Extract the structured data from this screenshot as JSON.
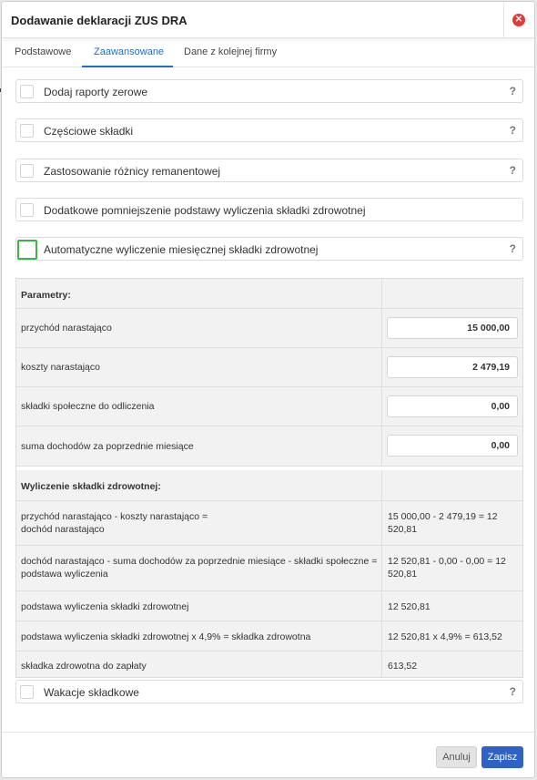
{
  "dialog": {
    "title": "Dodawanie deklaracji ZUS DRA",
    "close_glyph": "✕"
  },
  "tabs": [
    {
      "label": "Podstawowe",
      "active": false
    },
    {
      "label": "Zaawansowane",
      "active": true
    },
    {
      "label": "Dane z kolejnej firmy",
      "active": false
    }
  ],
  "options": [
    {
      "label": "Dodaj raporty zerowe",
      "help": "?",
      "checked": false
    },
    {
      "label": "Częściowe składki",
      "help": "?",
      "checked": false
    },
    {
      "label": "Zastosowanie różnicy remanentowej",
      "help": "?",
      "checked": false
    },
    {
      "label": "Dodatkowe pomniejszenie podstawy wyliczenia składki zdrowotnej",
      "help": "",
      "checked": false
    },
    {
      "label": "Automatyczne wyliczenie miesięcznej składki zdrowotnej",
      "help": "?",
      "checked": false,
      "focused": true
    },
    {
      "label": "Wakacje składkowe",
      "help": "?",
      "checked": false
    }
  ],
  "params": {
    "heading": "Parametry:",
    "inputs": [
      {
        "label": "przychód narastająco",
        "value": "15 000,00"
      },
      {
        "label": "koszty narastająco",
        "value": "2 479,19"
      },
      {
        "label": "składki społeczne do odliczenia",
        "value": "0,00"
      },
      {
        "label": "suma dochodów za poprzednie miesiące",
        "value": "0,00"
      }
    ]
  },
  "calc": {
    "heading": "Wyliczenie składki zdrowotnej:",
    "rows": [
      {
        "label_1": "przychód narastająco - koszty narastająco =",
        "label_2": "dochód narastająco",
        "value_1": "15 000,00 - 2 479,19 = 12",
        "value_2": "520,81"
      },
      {
        "label_1": "dochód narastająco - suma dochodów za poprzednie miesiące - składki społeczne =",
        "label_2": "podstawa wyliczenia",
        "value_1": "12 520,81 - 0,00 - 0,00 = 12",
        "value_2": "520,81"
      },
      {
        "label_1": "podstawa wyliczenia składki zdrowotnej",
        "label_2": "",
        "value_1": "12 520,81",
        "value_2": ""
      },
      {
        "label_1": "podstawa wyliczenia składki zdrowotnej x 4,9% = składka zdrowotna",
        "label_2": "",
        "value_1": "12 520,81 x 4,9% = 613,52",
        "value_2": ""
      },
      {
        "label_1": "składka zdrowotna do zapłaty",
        "label_2": "",
        "value_1": "613,52",
        "value_2": ""
      }
    ]
  },
  "footer": {
    "cancel_label": "Anuluj",
    "save_label": "Zapisz"
  },
  "colors": {
    "accent": "#1e6fc9",
    "save_button": "#2e62c7",
    "close": "#e53935",
    "focus_border": "#3cb24a"
  }
}
